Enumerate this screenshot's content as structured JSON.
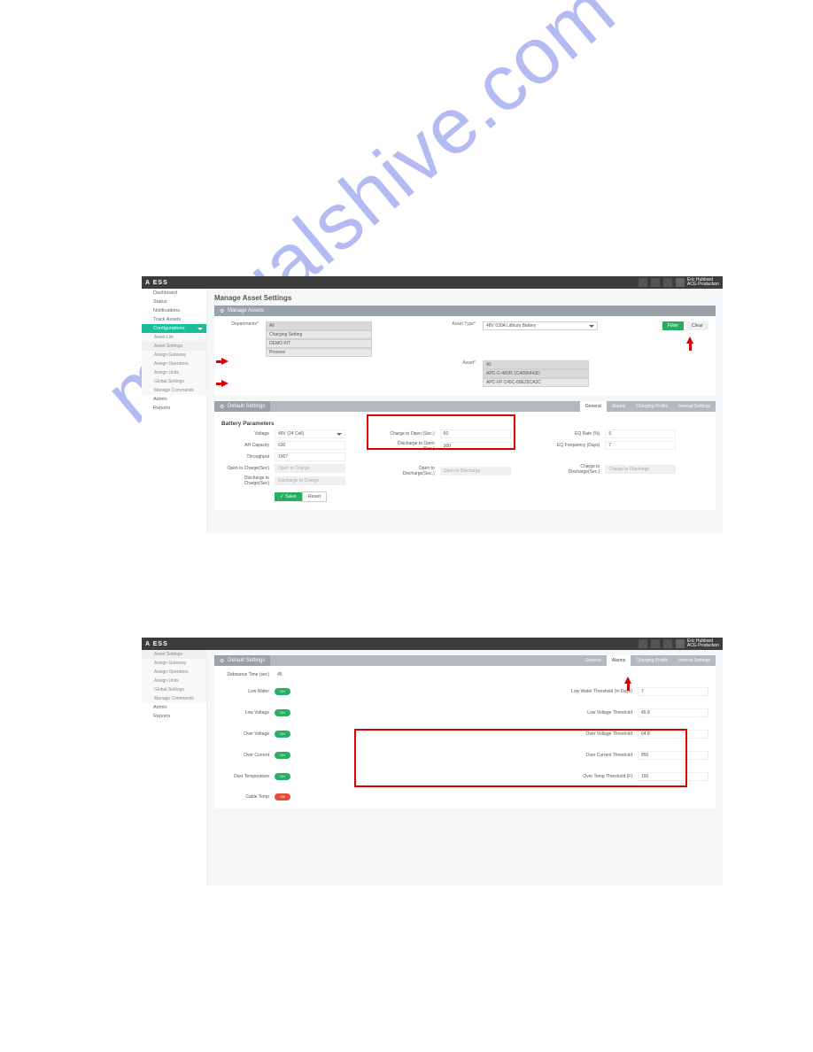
{
  "watermark": "manualshive.com",
  "brand": "A ESS",
  "user": {
    "name": "Eric Hubbard",
    "org": "ACG Production"
  },
  "sidebar": {
    "items": [
      {
        "label": "Dashboard"
      },
      {
        "label": "Status"
      },
      {
        "label": "Notifications"
      },
      {
        "label": "Track Assets"
      },
      {
        "label": "Configurations",
        "active": true
      }
    ],
    "config_sub": [
      {
        "label": "Asset List"
      },
      {
        "label": "Asset Settings",
        "hl": true
      },
      {
        "label": "Assign Gateway"
      },
      {
        "label": "Assign Operators"
      },
      {
        "label": "Assign Units"
      },
      {
        "label": "Global Settings"
      },
      {
        "label": "Manage Commands"
      }
    ],
    "lower": [
      {
        "label": "Admin"
      },
      {
        "label": "Reports"
      }
    ]
  },
  "page_title": "Manage Asset Settings",
  "bar_manage": "Manage Assets",
  "filters": {
    "dept_label": "Departments*",
    "dept_options": [
      "All",
      "Charging Setting",
      "DEMO KIT",
      "Process"
    ],
    "type_label": "Asset Type*",
    "type_value": "48V 630A Lithium Battery",
    "asset_label": "Asset*",
    "asset_options": [
      "All",
      "APC-C-48VR 1C4006443D",
      "APC-FP C45C-68E25CA2C"
    ],
    "filter_btn": "Filter",
    "clear_btn": "Clear"
  },
  "bar_default": "Default Settings",
  "tabs": [
    "General",
    "Alarms",
    "Charging Profile",
    "Interval Settings"
  ],
  "battery_section": "Battery Parameters",
  "params1": {
    "voltage_label": "Voltage",
    "voltage_value": "48V (24 Cell)",
    "ah_label": "AH Capacity",
    "ah_value": "630",
    "throughput_label": "Throughput",
    "throughput_value": "1007",
    "open_to_charge_label": "Open to Charge(Sec)",
    "open_to_charge_value": "Open to Charge",
    "discharge_to_charge_label": "Discharge to Charge(Sec)",
    "discharge_to_charge_value": "Discharge to Charge",
    "charge_to_open_label": "Charge to Open (Sec.)",
    "charge_to_open_value": "60",
    "discharge_to_open_label": "Discharge to Open (Sec.)",
    "discharge_to_open_value": "300",
    "open_to_discharge_label": "Open to Discharge(Sec.)",
    "open_to_discharge_value": "Open to Discharge",
    "eq_rate_label": "EQ Rate (%)",
    "eq_rate_value": "5",
    "eq_freq_label": "EQ Frequency (Days)",
    "eq_freq_value": "7",
    "charge_to_discharge_label": "Charge to Discharge(Sec.)",
    "charge_to_discharge_value": "Charge to Discharge",
    "save": "✓ Save",
    "reset": "Reset"
  },
  "alarms": {
    "debounce_label": "Debounce Time (sec)",
    "debounce_value": "45",
    "low_water_label": "Low Water",
    "low_water_on": true,
    "low_water_thresh_label": "Low Water Threshold (In Days)",
    "low_water_thresh_value": "7",
    "low_voltage_label": "Low Voltage",
    "low_voltage_on": true,
    "low_voltage_thresh_label": "Low Voltage Threshold",
    "low_voltage_thresh_value": "45.8",
    "over_voltage_label": "Over Voltage",
    "over_voltage_on": true,
    "over_voltage_thresh_label": "Over Voltage Threshold",
    "over_voltage_thresh_value": "64.8",
    "over_current_label": "Over Current",
    "over_current_on": true,
    "over_current_thresh_label": "Over Current Threshold",
    "over_current_thresh_value": "850",
    "over_temp_label": "Over Temperature",
    "over_temp_on": true,
    "over_temp_thresh_label": "Over Temp Threshold (F)",
    "over_temp_thresh_value": "150",
    "cable_temp_label": "Cable Temp",
    "cable_temp_on": false,
    "on_text": "On",
    "off_text": "Off"
  }
}
